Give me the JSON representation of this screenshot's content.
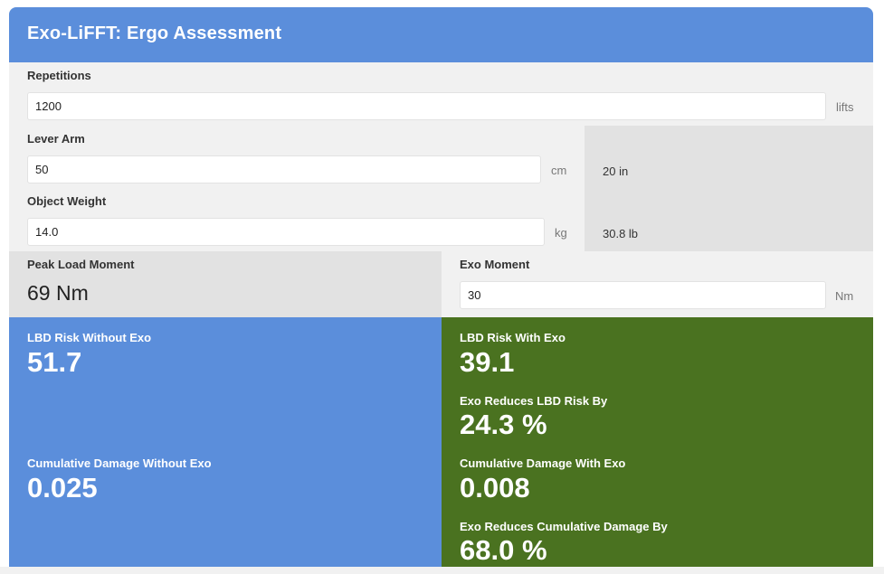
{
  "header": {
    "title": "Exo-LiFFT: Ergo Assessment"
  },
  "inputs": {
    "repetitions": {
      "label": "Repetitions",
      "value": "1200",
      "unit": "lifts"
    },
    "lever_arm": {
      "label": "Lever Arm",
      "value": "50",
      "unit": "cm",
      "imperial": "20 in"
    },
    "object_weight": {
      "label": "Object Weight",
      "value": "14.0",
      "unit": "kg",
      "imperial": "30.8 lb"
    },
    "exo_moment": {
      "label": "Exo Moment",
      "value": "30",
      "unit": "Nm"
    }
  },
  "peak_load_moment": {
    "label": "Peak Load Moment",
    "value": "69 Nm"
  },
  "results_without": {
    "lbd_risk_label": "LBD Risk Without Exo",
    "lbd_risk_value": "51.7",
    "cum_damage_label": "Cumulative Damage Without Exo",
    "cum_damage_value": "0.025",
    "color": "#5b8edb"
  },
  "results_with": {
    "lbd_risk_label": "LBD Risk With Exo",
    "lbd_risk_value": "39.1",
    "lbd_reduction_label": "Exo Reduces LBD Risk By",
    "lbd_reduction_value": "24.3 %",
    "cum_damage_label": "Cumulative Damage With Exo",
    "cum_damage_value": "0.008",
    "cum_reduction_label": "Exo Reduces Cumulative Damage By",
    "cum_reduction_value": "68.0 %",
    "color": "#4a7220"
  }
}
